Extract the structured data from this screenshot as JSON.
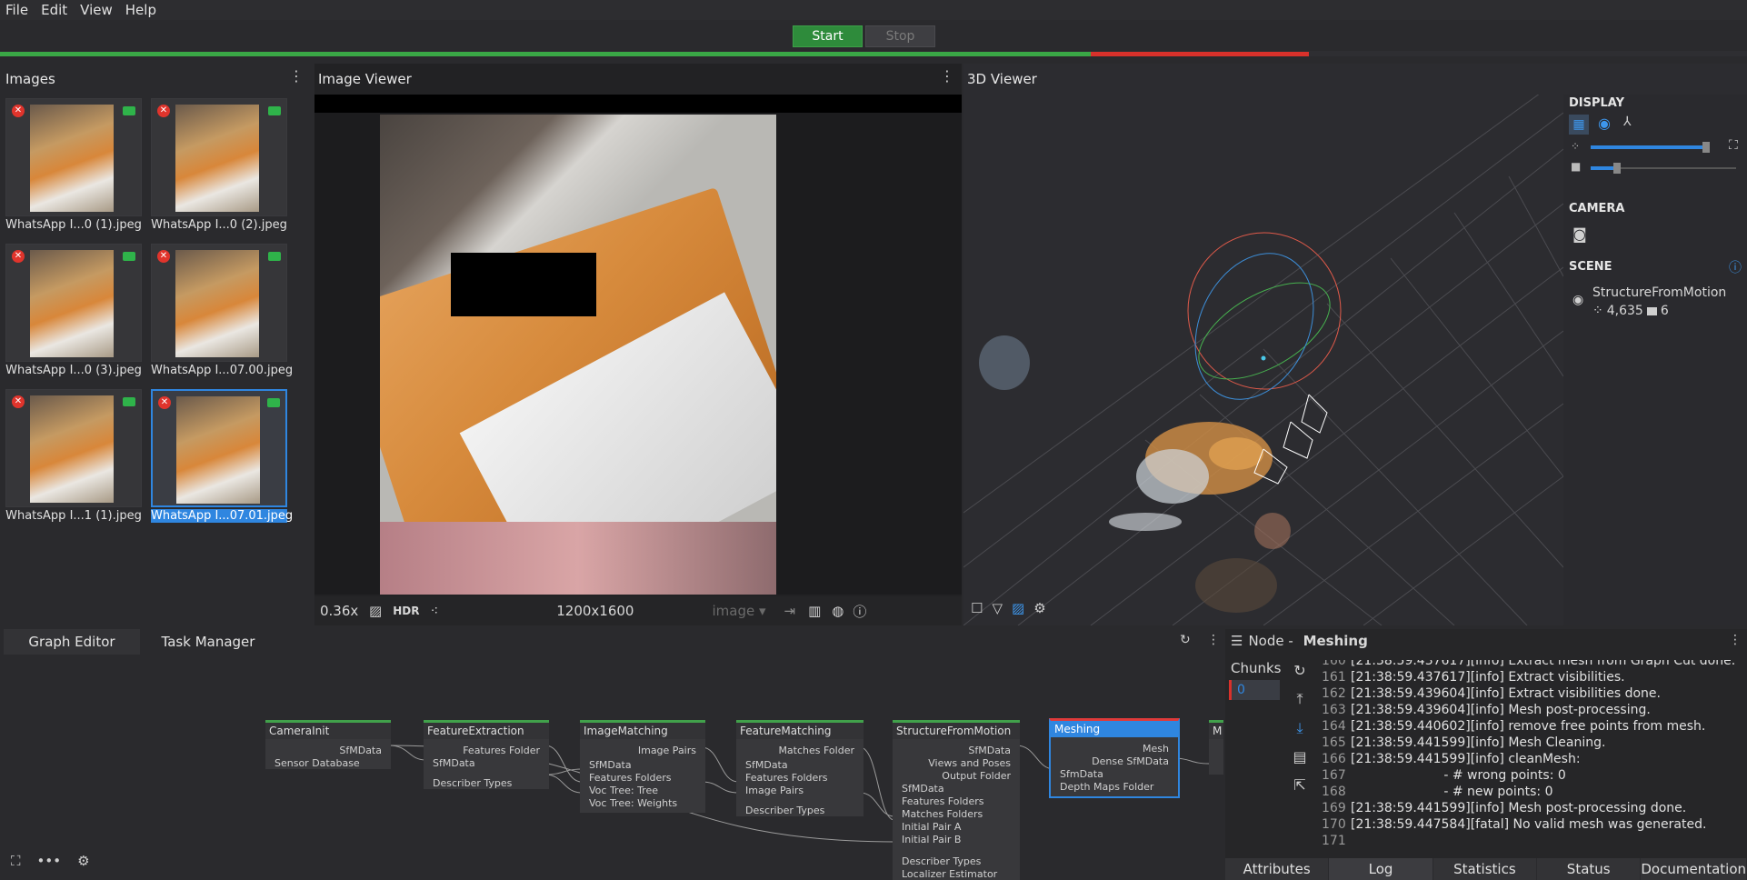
{
  "menu": {
    "items": [
      "File",
      "Edit",
      "View",
      "Help"
    ]
  },
  "toolbar": {
    "start_label": "Start",
    "stop_label": "Stop"
  },
  "colors": {
    "accent": "#2f86e0",
    "success": "#3aa846",
    "error": "#d8312b"
  },
  "images_panel": {
    "title": "Images",
    "thumbnails": [
      {
        "caption": "WhatsApp I...0 (1).jpeg",
        "selected": false
      },
      {
        "caption": "WhatsApp I...0 (2).jpeg",
        "selected": false
      },
      {
        "caption": "WhatsApp I...0 (3).jpeg",
        "selected": false
      },
      {
        "caption": "WhatsApp I...07.00.jpeg",
        "selected": false
      },
      {
        "caption": "WhatsApp I...1 (1).jpeg",
        "selected": false
      },
      {
        "caption": "WhatsApp I...07.01.jpeg",
        "selected": true
      }
    ],
    "footer": {
      "image_count": "6",
      "camera_count": "6",
      "thumbnail_size_fraction": 0.62
    }
  },
  "image_viewer": {
    "title": "Image Viewer",
    "zoom": "0.36x",
    "hdr_label": "HDR",
    "resolution": "1200x1600",
    "channel_select": "image"
  },
  "viewer3d": {
    "title": "3D Viewer",
    "display_section": "DISPLAY",
    "camera_section": "CAMERA",
    "scene_section": "SCENE",
    "point_size_fraction": 0.98,
    "camera_scale_fraction": 0.18,
    "scene_item": {
      "name": "StructureFromMotion",
      "points": "4,635",
      "cameras": "6"
    }
  },
  "bottom": {
    "tabs": [
      "Graph Editor",
      "Task Manager"
    ],
    "active_tab": "Graph Editor"
  },
  "graph": {
    "nodes": [
      {
        "title": "CameraInit",
        "outputs": [
          "SfMData"
        ],
        "inputs": [
          "Sensor Database"
        ],
        "selected": false
      },
      {
        "title": "FeatureExtraction",
        "outputs": [
          "Features Folder"
        ],
        "inputs": [
          "SfMData",
          "Describer Types"
        ],
        "selected": false
      },
      {
        "title": "ImageMatching",
        "outputs": [
          "Image Pairs"
        ],
        "inputs": [
          "SfMData",
          "Features Folders",
          "Voc Tree: Tree",
          "Voc Tree: Weights"
        ],
        "selected": false
      },
      {
        "title": "FeatureMatching",
        "outputs": [
          "Matches Folder"
        ],
        "inputs": [
          "SfMData",
          "Features Folders",
          "Image Pairs",
          "Describer Types"
        ],
        "selected": false
      },
      {
        "title": "StructureFromMotion",
        "outputs": [
          "SfMData",
          "Views and Poses",
          "Output Folder"
        ],
        "inputs": [
          "SfMData",
          "Features Folders",
          "Matches Folders",
          "Initial Pair A",
          "Initial Pair B",
          "Describer Types",
          "Localizer Estimator"
        ],
        "selected": false
      },
      {
        "title": "Meshing",
        "outputs": [
          "Mesh",
          "Dense SfMData"
        ],
        "inputs": [
          "SfmData",
          "Depth Maps Folder"
        ],
        "selected": true
      },
      {
        "title": "M",
        "outputs": [],
        "inputs": [],
        "selected": false
      }
    ]
  },
  "node_panel": {
    "title_prefix": "Node - ",
    "node_name": "Meshing",
    "chunks_label": "Chunks",
    "chunk_index": "0",
    "log_lines": [
      {
        "n": "160",
        "text": "[21:38:59.437617][info] Extract mesh from Graph Cut done."
      },
      {
        "n": "161",
        "text": "[21:38:59.437617][info] Extract visibilities."
      },
      {
        "n": "162",
        "text": "[21:38:59.439604][info] Extract visibilities done."
      },
      {
        "n": "163",
        "text": "[21:38:59.439604][info] Mesh post-processing."
      },
      {
        "n": "164",
        "text": "[21:38:59.440602][info] remove free points from mesh."
      },
      {
        "n": "165",
        "text": "[21:38:59.441599][info] Mesh Cleaning."
      },
      {
        "n": "166",
        "text": "[21:38:59.441599][info] cleanMesh:"
      },
      {
        "n": "167",
        "text": "                       - # wrong points: 0"
      },
      {
        "n": "168",
        "text": "                       - # new points: 0"
      },
      {
        "n": "169",
        "text": "[21:38:59.441599][info] Mesh post-processing done."
      },
      {
        "n": "170",
        "text": "[21:38:59.447584][fatal] No valid mesh was generated."
      },
      {
        "n": "171",
        "text": ""
      }
    ],
    "bottom_tabs": [
      "Attributes",
      "Log",
      "Statistics",
      "Status",
      "Documentation"
    ],
    "active_bottom_tab": "Log"
  }
}
